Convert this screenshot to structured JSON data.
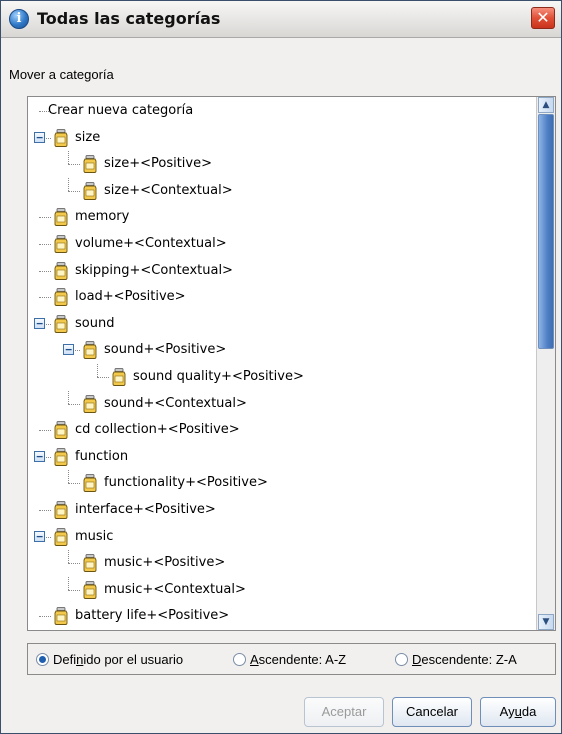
{
  "window": {
    "title": "Todas las categorías",
    "close_glyph": "✕",
    "app_icon_glyph": "i"
  },
  "group_label": "Mover a categoría",
  "tree": {
    "items": [
      {
        "label": "Crear nueva categoría",
        "level": 0,
        "expander": null,
        "icon": null
      },
      {
        "label": "size",
        "level": 0,
        "expander": "−",
        "icon": "jar-icon"
      },
      {
        "label": "size+<Positive>",
        "level": 1,
        "expander": null,
        "icon": "jar-icon"
      },
      {
        "label": "size+<Contextual>",
        "level": 1,
        "expander": null,
        "icon": "jar-icon"
      },
      {
        "label": "memory",
        "level": 0,
        "expander": null,
        "icon": "jar-icon"
      },
      {
        "label": "volume+<Contextual>",
        "level": 0,
        "expander": null,
        "icon": "jar-icon"
      },
      {
        "label": "skipping+<Contextual>",
        "level": 0,
        "expander": null,
        "icon": "jar-icon"
      },
      {
        "label": "load+<Positive>",
        "level": 0,
        "expander": null,
        "icon": "jar-icon"
      },
      {
        "label": "sound",
        "level": 0,
        "expander": "−",
        "icon": "jar-icon"
      },
      {
        "label": "sound+<Positive>",
        "level": 1,
        "expander": "−",
        "icon": "jar-icon"
      },
      {
        "label": "sound quality+<Positive>",
        "level": 2,
        "expander": null,
        "icon": "jar-icon"
      },
      {
        "label": "sound+<Contextual>",
        "level": 1,
        "expander": null,
        "icon": "jar-icon"
      },
      {
        "label": "cd collection+<Positive>",
        "level": 0,
        "expander": null,
        "icon": "jar-icon"
      },
      {
        "label": "function",
        "level": 0,
        "expander": "−",
        "icon": "jar-icon"
      },
      {
        "label": "functionality+<Positive>",
        "level": 1,
        "expander": null,
        "icon": "jar-icon"
      },
      {
        "label": "interface+<Positive>",
        "level": 0,
        "expander": null,
        "icon": "jar-icon"
      },
      {
        "label": "music",
        "level": 0,
        "expander": "−",
        "icon": "jar-icon"
      },
      {
        "label": "music+<Positive>",
        "level": 1,
        "expander": null,
        "icon": "jar-icon"
      },
      {
        "label": "music+<Contextual>",
        "level": 1,
        "expander": null,
        "icon": "jar-icon"
      },
      {
        "label": "battery life+<Positive>",
        "level": 0,
        "expander": null,
        "icon": "jar-icon"
      }
    ]
  },
  "scrollbar": {
    "up_glyph": "▲",
    "down_glyph": "▼"
  },
  "sort": {
    "options": [
      {
        "pre": "Defi",
        "u": "n",
        "post": "ido por el usuario",
        "selected": true
      },
      {
        "pre": "",
        "u": "A",
        "post": "scendente: A-Z",
        "selected": false
      },
      {
        "pre": "",
        "u": "D",
        "post": "escendente: Z-A",
        "selected": false
      }
    ]
  },
  "buttons": {
    "accept": "Aceptar",
    "cancel": "Cancelar",
    "help_pre": "Ay",
    "help_u": "u",
    "help_post": "da"
  }
}
